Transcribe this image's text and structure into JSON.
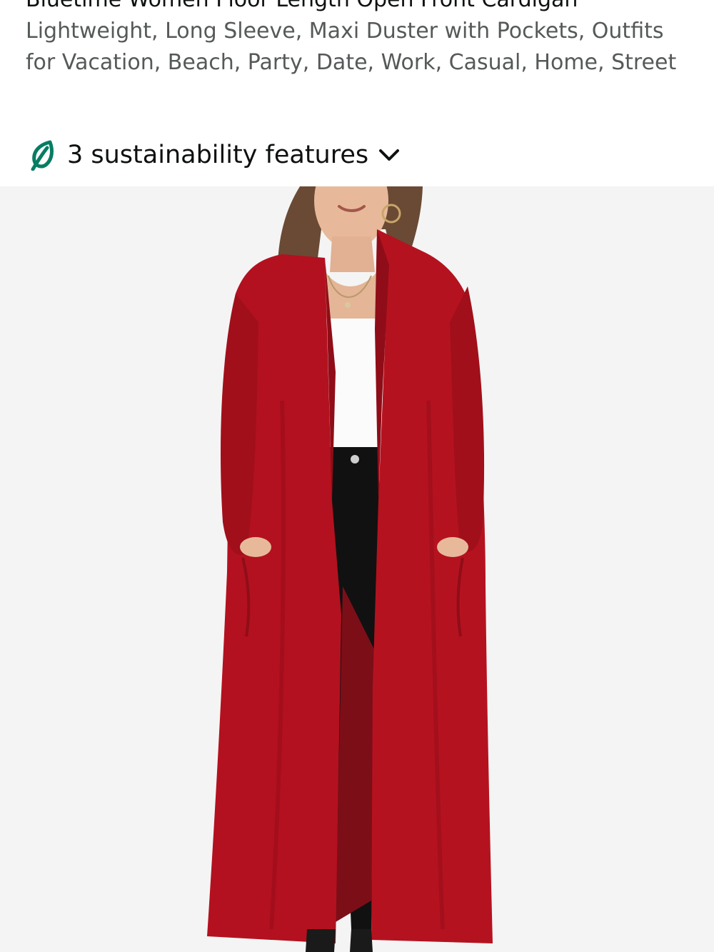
{
  "product": {
    "title_line1": "Bluetime Women Floor Length Open Front Cardigan",
    "title_rest": "Lightweight, Long Sleeve, Maxi Duster with Pockets, Outfits for Vacation, Beach, Party, Date, Work, Casual, Home, Street"
  },
  "sustainability": {
    "label": "3 sustainability features",
    "icon": "leaf-icon",
    "expand_icon": "chevron-down-icon",
    "icon_color": "#067d62"
  },
  "image": {
    "alt": "Woman wearing a long red open front cardigan over white top and black jeans",
    "background": "#f4f4f4",
    "cardigan_color": "#b3111f"
  }
}
